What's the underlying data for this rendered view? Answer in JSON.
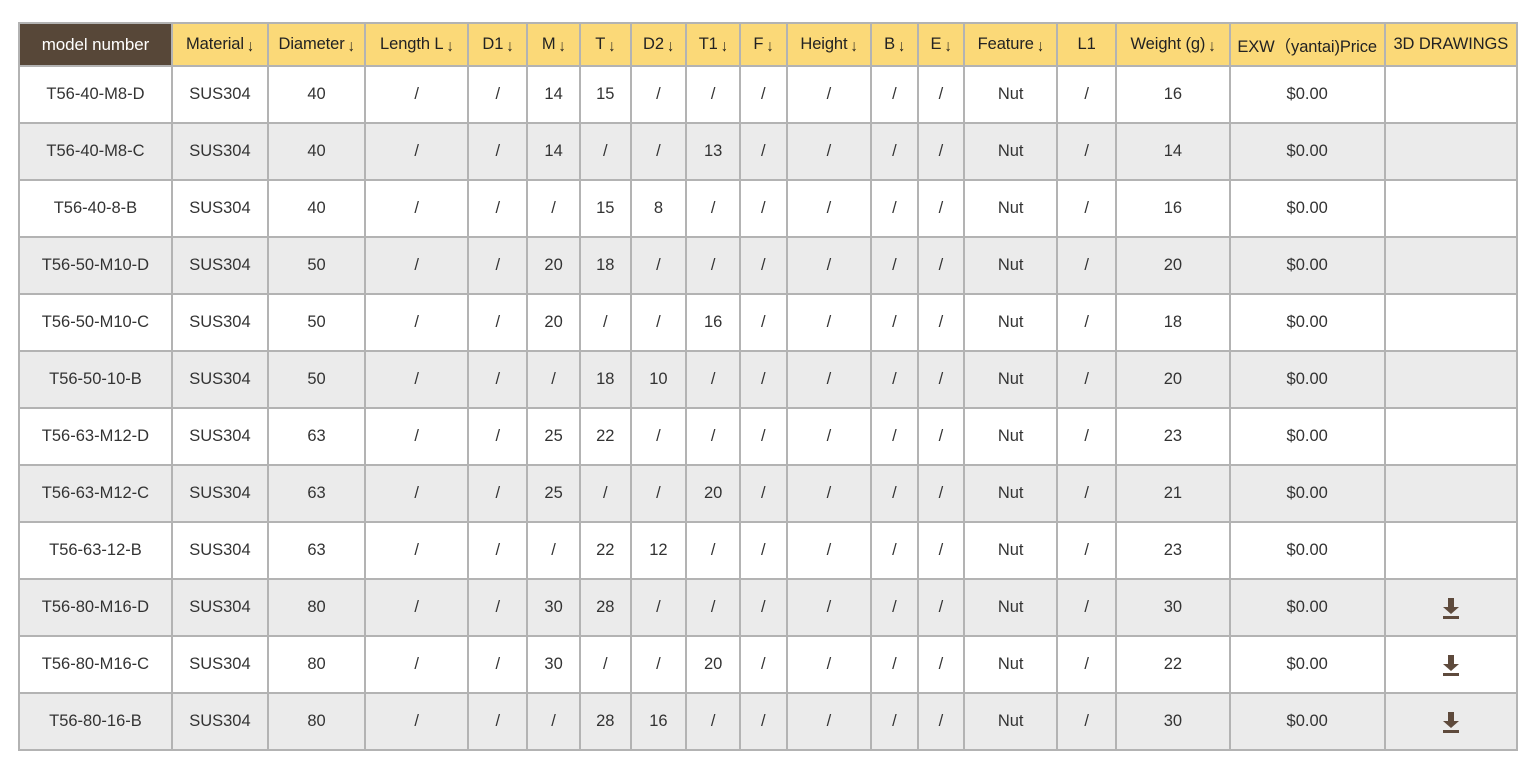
{
  "theme": {
    "header_accent": "#FBD978",
    "header_first_cell": "#574738",
    "row_alt": "#EBEBEB",
    "border": "#B3B3B3",
    "icon_brown": "#5E4A3C",
    "text": "#333333"
  },
  "table": {
    "name": "product-specification-table",
    "sort_arrow_glyph": "↓",
    "columns": [
      {
        "label": "model number",
        "sortable": false,
        "first": true
      },
      {
        "label": "Material",
        "sortable": true
      },
      {
        "label": "Diameter",
        "sortable": true
      },
      {
        "label": "Length L",
        "sortable": true
      },
      {
        "label": "D1",
        "sortable": true
      },
      {
        "label": "M",
        "sortable": true
      },
      {
        "label": "T",
        "sortable": true
      },
      {
        "label": "D2",
        "sortable": true
      },
      {
        "label": "T1",
        "sortable": true
      },
      {
        "label": "F",
        "sortable": true
      },
      {
        "label": "Height",
        "sortable": true
      },
      {
        "label": "B",
        "sortable": true
      },
      {
        "label": "E",
        "sortable": true
      },
      {
        "label": "Feature",
        "sortable": true
      },
      {
        "label": "L1",
        "sortable": false
      },
      {
        "label": "Weight (g)",
        "sortable": true
      },
      {
        "label": "EXW（yantai)Price",
        "sortable": false
      },
      {
        "label": "3D DRAWINGS",
        "sortable": false
      }
    ],
    "rows": [
      {
        "model_number": "T56-40-M8-D",
        "material": "SUS304",
        "diameter": "40",
        "length_l": "/",
        "d1": "/",
        "m": "14",
        "t": "15",
        "d2": "/",
        "t1": "/",
        "f": "/",
        "height": "/",
        "b": "/",
        "e": "/",
        "feature": "Nut",
        "l1": "/",
        "weight_g": "16",
        "exw_price": "$0.00",
        "drawing": "",
        "shaded": false
      },
      {
        "model_number": "T56-40-M8-C",
        "material": "SUS304",
        "diameter": "40",
        "length_l": "/",
        "d1": "/",
        "m": "14",
        "t": "/",
        "d2": "/",
        "t1": "13",
        "f": "/",
        "height": "/",
        "b": "/",
        "e": "/",
        "feature": "Nut",
        "l1": "/",
        "weight_g": "14",
        "exw_price": "$0.00",
        "drawing": "",
        "shaded": true
      },
      {
        "model_number": "T56-40-8-B",
        "material": "SUS304",
        "diameter": "40",
        "length_l": "/",
        "d1": "/",
        "m": "/",
        "t": "15",
        "d2": "8",
        "t1": "/",
        "f": "/",
        "height": "/",
        "b": "/",
        "e": "/",
        "feature": "Nut",
        "l1": "/",
        "weight_g": "16",
        "exw_price": "$0.00",
        "drawing": "",
        "shaded": false
      },
      {
        "model_number": "T56-50-M10-D",
        "material": "SUS304",
        "diameter": "50",
        "length_l": "/",
        "d1": "/",
        "m": "20",
        "t": "18",
        "d2": "/",
        "t1": "/",
        "f": "/",
        "height": "/",
        "b": "/",
        "e": "/",
        "feature": "Nut",
        "l1": "/",
        "weight_g": "20",
        "exw_price": "$0.00",
        "drawing": "",
        "shaded": true
      },
      {
        "model_number": "T56-50-M10-C",
        "material": "SUS304",
        "diameter": "50",
        "length_l": "/",
        "d1": "/",
        "m": "20",
        "t": "/",
        "d2": "/",
        "t1": "16",
        "f": "/",
        "height": "/",
        "b": "/",
        "e": "/",
        "feature": "Nut",
        "l1": "/",
        "weight_g": "18",
        "exw_price": "$0.00",
        "drawing": "",
        "shaded": false
      },
      {
        "model_number": "T56-50-10-B",
        "material": "SUS304",
        "diameter": "50",
        "length_l": "/",
        "d1": "/",
        "m": "/",
        "t": "18",
        "d2": "10",
        "t1": "/",
        "f": "/",
        "height": "/",
        "b": "/",
        "e": "/",
        "feature": "Nut",
        "l1": "/",
        "weight_g": "20",
        "exw_price": "$0.00",
        "drawing": "",
        "shaded": true
      },
      {
        "model_number": "T56-63-M12-D",
        "material": "SUS304",
        "diameter": "63",
        "length_l": "/",
        "d1": "/",
        "m": "25",
        "t": "22",
        "d2": "/",
        "t1": "/",
        "f": "/",
        "height": "/",
        "b": "/",
        "e": "/",
        "feature": "Nut",
        "l1": "/",
        "weight_g": "23",
        "exw_price": "$0.00",
        "drawing": "",
        "shaded": false
      },
      {
        "model_number": "T56-63-M12-C",
        "material": "SUS304",
        "diameter": "63",
        "length_l": "/",
        "d1": "/",
        "m": "25",
        "t": "/",
        "d2": "/",
        "t1": "20",
        "f": "/",
        "height": "/",
        "b": "/",
        "e": "/",
        "feature": "Nut",
        "l1": "/",
        "weight_g": "21",
        "exw_price": "$0.00",
        "drawing": "",
        "shaded": true
      },
      {
        "model_number": "T56-63-12-B",
        "material": "SUS304",
        "diameter": "63",
        "length_l": "/",
        "d1": "/",
        "m": "/",
        "t": "22",
        "d2": "12",
        "t1": "/",
        "f": "/",
        "height": "/",
        "b": "/",
        "e": "/",
        "feature": "Nut",
        "l1": "/",
        "weight_g": "23",
        "exw_price": "$0.00",
        "drawing": "",
        "shaded": false
      },
      {
        "model_number": "T56-80-M16-D",
        "material": "SUS304",
        "diameter": "80",
        "length_l": "/",
        "d1": "/",
        "m": "30",
        "t": "28",
        "d2": "/",
        "t1": "/",
        "f": "/",
        "height": "/",
        "b": "/",
        "e": "/",
        "feature": "Nut",
        "l1": "/",
        "weight_g": "30",
        "exw_price": "$0.00",
        "drawing": "download-icon",
        "shaded": true
      },
      {
        "model_number": "T56-80-M16-C",
        "material": "SUS304",
        "diameter": "80",
        "length_l": "/",
        "d1": "/",
        "m": "30",
        "t": "/",
        "d2": "/",
        "t1": "20",
        "f": "/",
        "height": "/",
        "b": "/",
        "e": "/",
        "feature": "Nut",
        "l1": "/",
        "weight_g": "22",
        "exw_price": "$0.00",
        "drawing": "download-icon",
        "shaded": false
      },
      {
        "model_number": "T56-80-16-B",
        "material": "SUS304",
        "diameter": "80",
        "length_l": "/",
        "d1": "/",
        "m": "/",
        "t": "28",
        "d2": "16",
        "t1": "/",
        "f": "/",
        "height": "/",
        "b": "/",
        "e": "/",
        "feature": "Nut",
        "l1": "/",
        "weight_g": "30",
        "exw_price": "$0.00",
        "drawing": "download-icon",
        "shaded": true
      }
    ]
  }
}
